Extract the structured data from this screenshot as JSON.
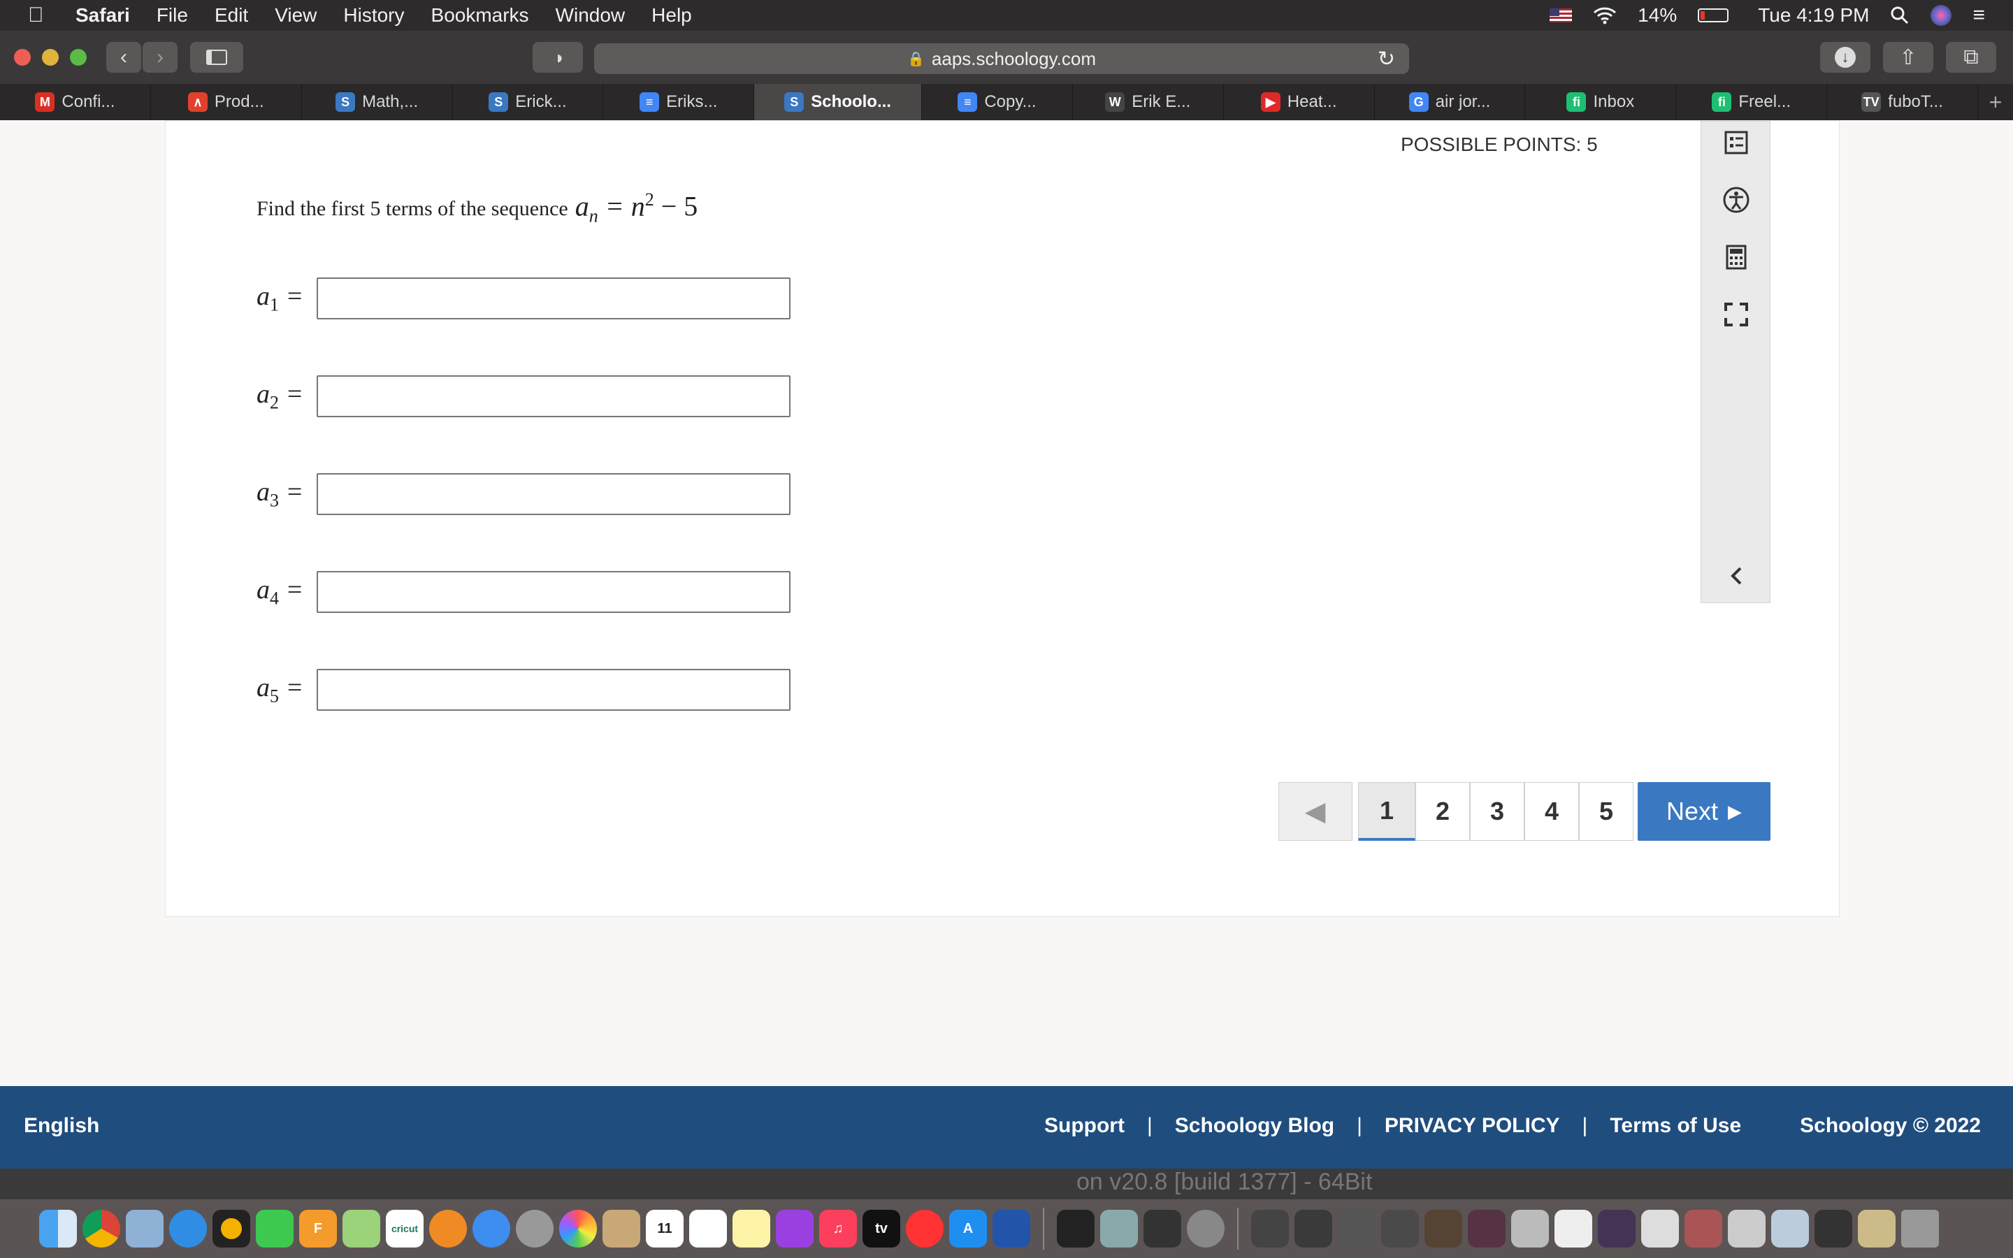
{
  "menubar": {
    "app": "Safari",
    "menus": [
      "File",
      "Edit",
      "View",
      "History",
      "Bookmarks",
      "Window",
      "Help"
    ],
    "battery": "14%",
    "clock": "Tue 4:19 PM"
  },
  "toolbar": {
    "url": "aaps.schoology.com"
  },
  "tabs": [
    {
      "label": "Confi...",
      "icon": "gmail-icon",
      "color": "#d93025",
      "glyph": "M"
    },
    {
      "label": "Prod...",
      "icon": "prod-icon",
      "color": "#e0412c",
      "glyph": "∧"
    },
    {
      "label": "Math,...",
      "icon": "schoology-icon",
      "color": "#3a78c2",
      "glyph": "S"
    },
    {
      "label": "Erick...",
      "icon": "schoology-icon",
      "color": "#3a78c2",
      "glyph": "S"
    },
    {
      "label": "Eriks...",
      "icon": "google-docs-icon",
      "color": "#4285f4",
      "glyph": "≡"
    },
    {
      "label": "Schoolo...",
      "icon": "schoology-icon",
      "color": "#3a78c2",
      "glyph": "S",
      "active": true
    },
    {
      "label": "Copy...",
      "icon": "google-docs-icon",
      "color": "#4285f4",
      "glyph": "≡"
    },
    {
      "label": "Erik E...",
      "icon": "wikipedia-icon",
      "color": "#444",
      "glyph": "W"
    },
    {
      "label": "Heat...",
      "icon": "youtube-icon",
      "color": "#e02828",
      "glyph": "▶"
    },
    {
      "label": "air jor...",
      "icon": "google-icon",
      "color": "#4285f4",
      "glyph": "G"
    },
    {
      "label": "Inbox",
      "icon": "fiverr-icon",
      "color": "#1dbf73",
      "glyph": "fi"
    },
    {
      "label": "Freel...",
      "icon": "fiverr-icon",
      "color": "#1dbf73",
      "glyph": "fi"
    },
    {
      "label": "fuboT...",
      "icon": "fubotv-icon",
      "color": "#555",
      "glyph": "TV"
    }
  ],
  "assessment": {
    "possible_points": "POSSIBLE POINTS: 5",
    "prompt": "Find the first 5 terms of the sequence",
    "formula_lhs": "a",
    "formula_lhs_sub": "n",
    "formula_eq": "= n",
    "formula_exp": "2",
    "formula_rest": "− 5",
    "terms": [
      {
        "var": "a",
        "sub": "1",
        "value": ""
      },
      {
        "var": "a",
        "sub": "2",
        "value": ""
      },
      {
        "var": "a",
        "sub": "3",
        "value": ""
      },
      {
        "var": "a",
        "sub": "4",
        "value": ""
      },
      {
        "var": "a",
        "sub": "5",
        "value": ""
      }
    ]
  },
  "pager": {
    "pages": [
      "1",
      "2",
      "3",
      "4",
      "5"
    ],
    "current": "1",
    "next_label": "Next"
  },
  "footer": {
    "language": "English",
    "links": [
      "Support",
      "Schoology Blog",
      "PRIVACY POLICY",
      "Terms of Use"
    ],
    "copyright": "Schoology © 2022"
  },
  "background_window_text": "on v20.8 [build 1377] - 64Bit",
  "colors": {
    "accent": "#3a78c2",
    "footer": "#1f4d7e"
  }
}
